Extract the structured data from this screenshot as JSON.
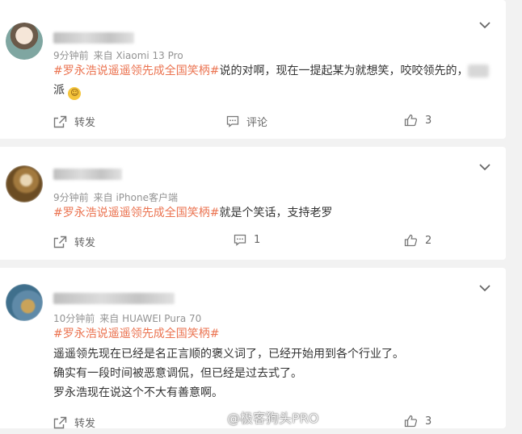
{
  "posts": [
    {
      "meta": {
        "time": "9分钟前",
        "source": "来自 Xiaomi 13 Pro"
      },
      "content": {
        "topic": "#罗永浩说遥遥领先成全国笑柄#",
        "text": "说的对啊，现在一提起某为就想笑，咬咬领先的，",
        "line2": "派"
      },
      "actions": {
        "repost": "转发",
        "comment": "评论",
        "like": "3"
      }
    },
    {
      "meta": {
        "time": "9分钟前",
        "source": "来自 iPhone客户端"
      },
      "content": {
        "topic": "#罗永浩说遥遥领先成全国笑柄#",
        "text": "就是个笑话，支持老罗"
      },
      "actions": {
        "repost": "转发",
        "comment": "1",
        "like": "2"
      }
    },
    {
      "meta": {
        "time": "10分钟前",
        "source": "来自 HUAWEI Pura 70"
      },
      "content": {
        "topic": "#罗永浩说遥遥领先成全国笑柄#",
        "lines": [
          "遥遥领先现在已经是名正言顺的褒义词了，已经开始用到各个行业了。",
          "确实有一段时间被恶意调侃，但已经是过去式了。",
          "罗永浩现在说这个不大有善意啊。"
        ]
      },
      "actions": {
        "repost": "转发",
        "comment": "",
        "like": "3"
      }
    }
  ],
  "watermark": "@极客狗头PRO",
  "colors": {
    "topic": "#eb7350",
    "meta": "#939393",
    "background": "#f2f2f2"
  }
}
